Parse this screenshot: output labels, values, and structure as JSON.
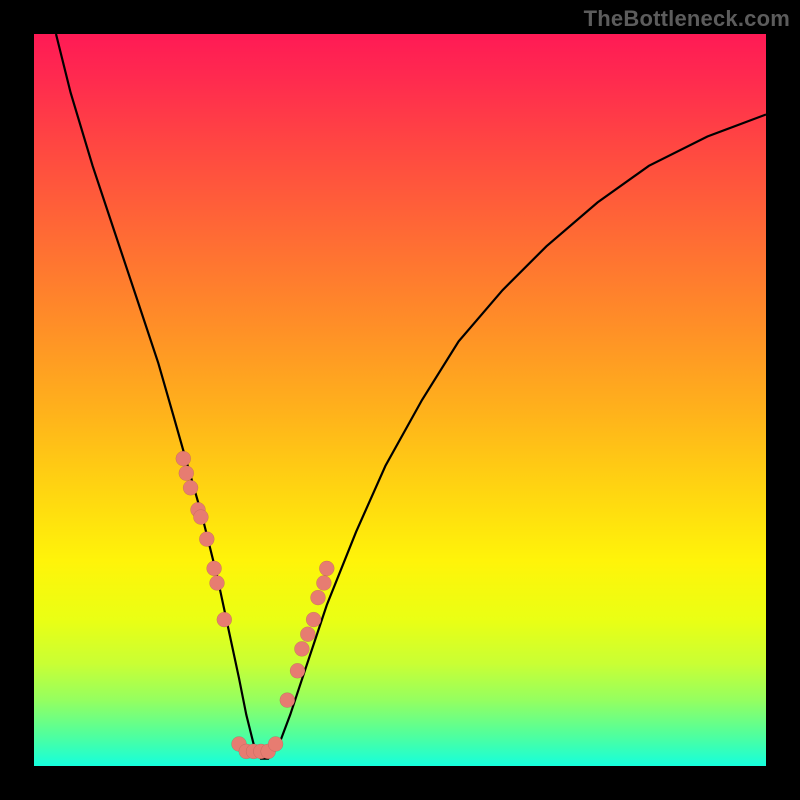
{
  "watermark": "TheBottleneck.com",
  "chart_data": {
    "type": "line",
    "title": "",
    "xlabel": "",
    "ylabel": "",
    "xlim": [
      0,
      100
    ],
    "ylim": [
      0,
      100
    ],
    "grid": false,
    "series": [
      {
        "name": "bottleneck-curve",
        "x": [
          3,
          5,
          8,
          11,
          14,
          17,
          19,
          21,
          23,
          25,
          26.5,
          28,
          29,
          30,
          31,
          32,
          33.5,
          35,
          37,
          40,
          44,
          48,
          53,
          58,
          64,
          70,
          77,
          84,
          92,
          100
        ],
        "y": [
          100,
          92,
          82,
          73,
          64,
          55,
          48,
          41,
          34,
          26,
          19,
          12,
          7,
          3,
          1,
          1,
          3,
          7,
          13,
          22,
          32,
          41,
          50,
          58,
          65,
          71,
          77,
          82,
          86,
          89
        ]
      }
    ],
    "points": {
      "name": "highlight-dots",
      "color": "#e77c71",
      "x": [
        20.4,
        20.8,
        21.4,
        22.4,
        22.8,
        23.6,
        24.6,
        25.0,
        26.0,
        28.0,
        29.0,
        30.0,
        31.0,
        32.0,
        33.0,
        34.6,
        36.0,
        36.6,
        37.4,
        38.2,
        38.8,
        39.6,
        40.0
      ],
      "y": [
        42,
        40,
        38,
        35,
        34,
        31,
        27,
        25,
        20,
        3,
        2,
        2,
        2,
        2,
        3,
        9,
        13,
        16,
        18,
        20,
        23,
        25,
        27
      ]
    }
  }
}
